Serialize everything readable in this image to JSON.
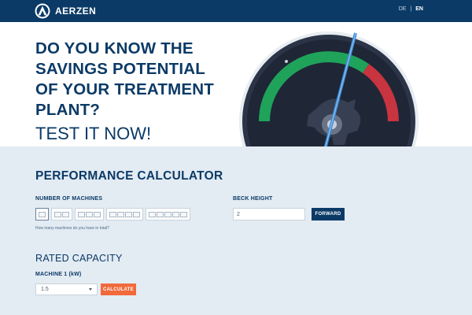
{
  "header": {
    "brand": "AERZEN",
    "languages": [
      "DE",
      "|",
      "EN"
    ],
    "active_language": "EN"
  },
  "hero": {
    "title": "DO YOU KNOW THE SAVINGS POTENTIAL OF YOUR TREATMENT PLANT?",
    "cta": "TEST IT NOW!"
  },
  "calculator": {
    "title": "PERFORMANCE CALCULATOR",
    "machines_label": "NUMBER OF MACHINES",
    "machine_options": [
      1,
      2,
      3,
      4,
      5
    ],
    "selected_machines": 1,
    "machines_hint": "How many machines do you have in total?",
    "beck_label": "BECK HEIGHT",
    "beck_value": "2",
    "forward_label": "FORWARD",
    "rated_title": "RATED CAPACITY",
    "machine1_label": "MACHINE 1 (kW)",
    "machine1_value": "1.5",
    "calculate_label": "CALCULATE"
  },
  "colors": {
    "navy": "#0b3a66",
    "accent_orange": "#f06a3c",
    "gauge_green": "#1fa35a",
    "gauge_red": "#c8343f",
    "needle_blue": "#3d8bd6"
  }
}
